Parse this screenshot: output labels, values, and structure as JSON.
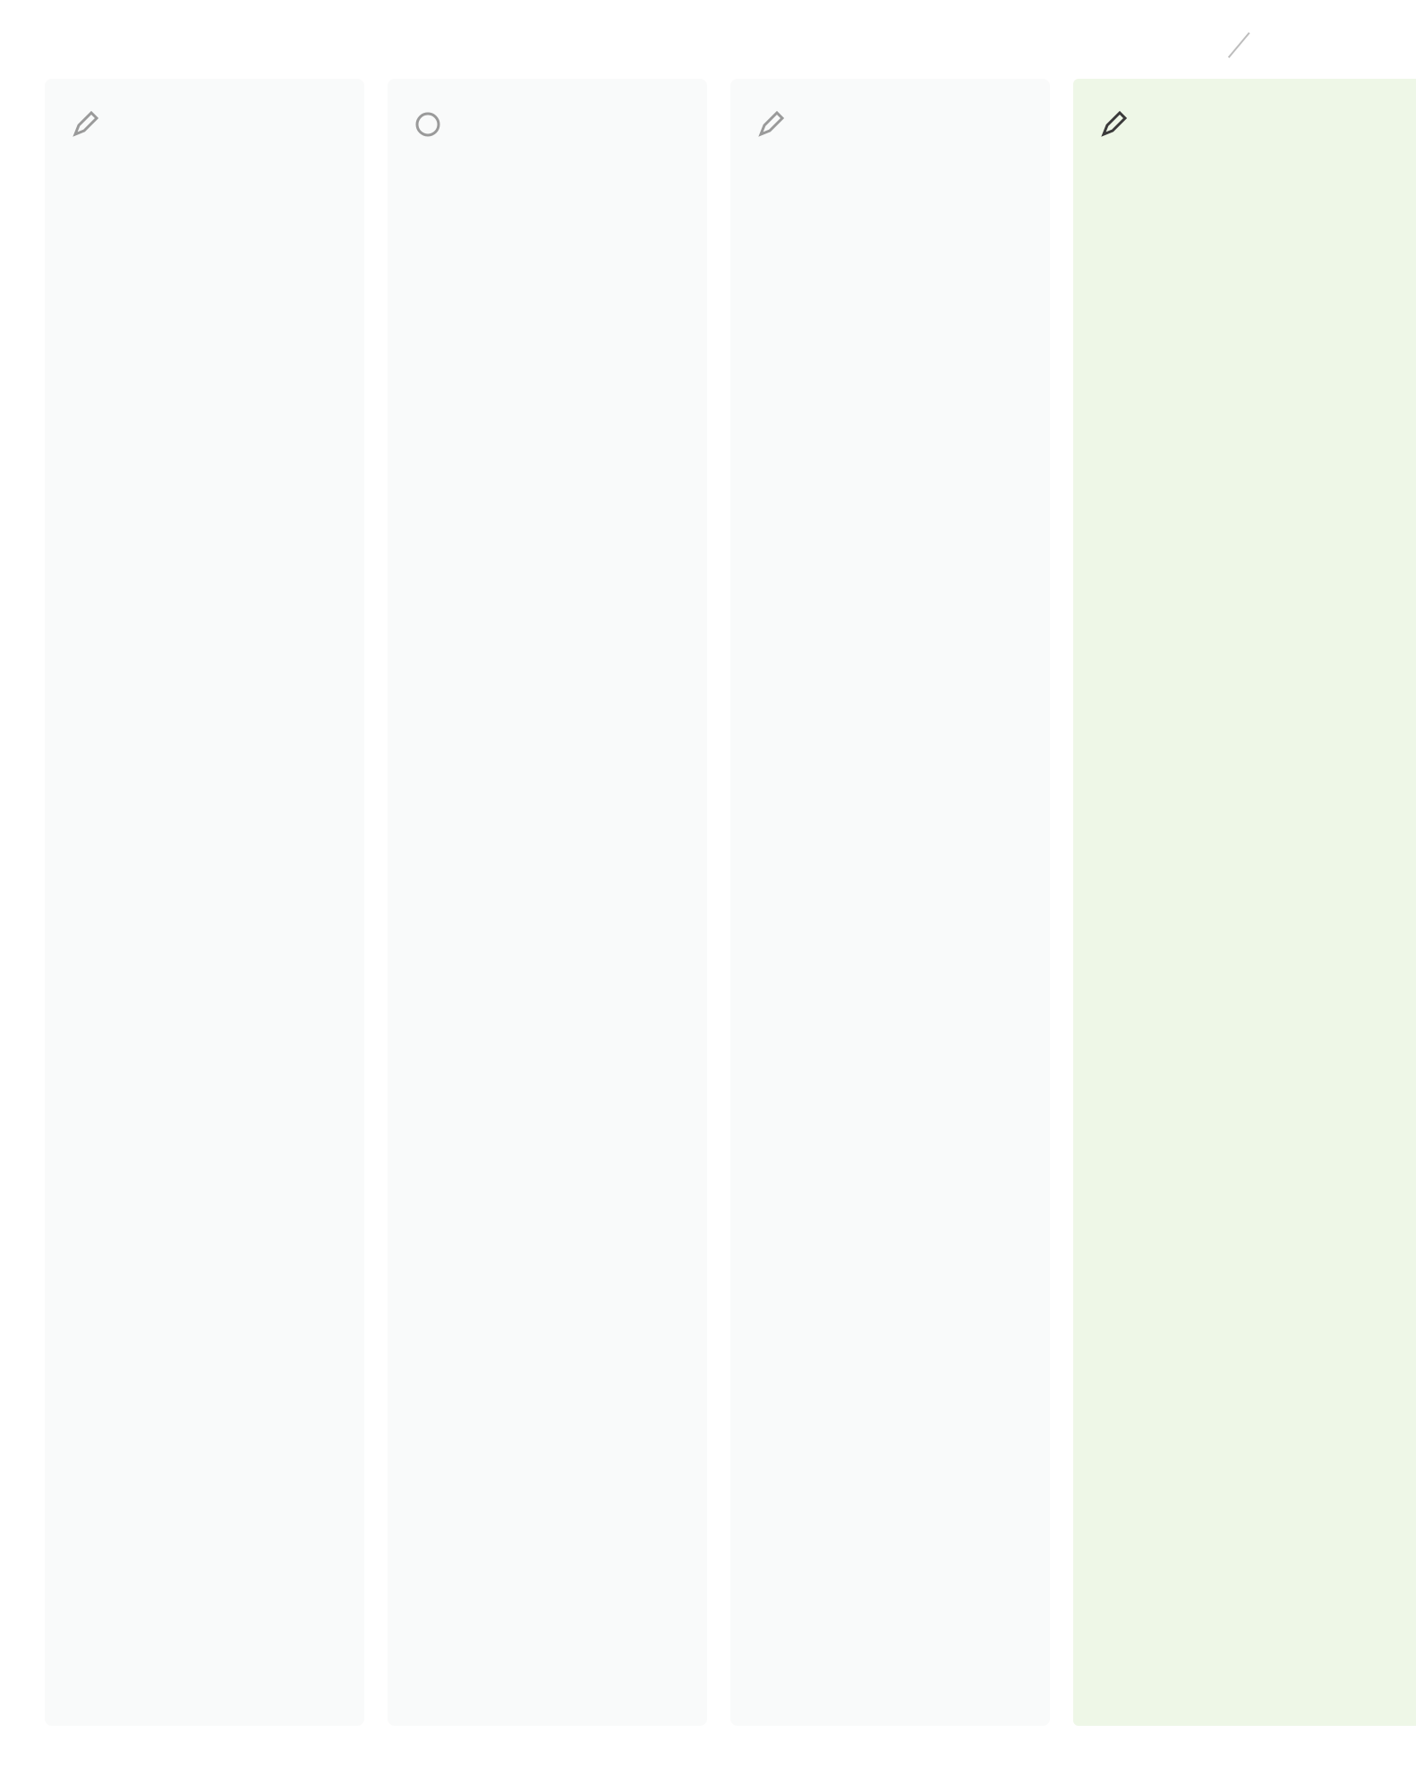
{
  "note": {
    "text": ""
  },
  "columns": [
    {
      "title": "",
      "icon": "pencil-icon",
      "sections": [
        {
          "label": "",
          "body": [
            ""
          ]
        },
        {
          "label": "",
          "body": [
            ""
          ]
        },
        {
          "label": "",
          "body": [
            ""
          ]
        },
        {
          "label": "",
          "body": [
            ""
          ]
        },
        {
          "label": "",
          "body": [
            ""
          ]
        }
      ]
    },
    {
      "title": "",
      "icon": "circle-icon",
      "sections": [
        {
          "label": "",
          "body": [
            ""
          ]
        },
        {
          "label": "",
          "body": [
            ""
          ]
        },
        {
          "label": "",
          "body": [
            ""
          ]
        },
        {
          "label": "",
          "body": [
            ""
          ]
        },
        {
          "label": "",
          "body": [
            ""
          ]
        }
      ]
    },
    {
      "title": "",
      "icon": "pencil-icon",
      "sections": [
        {
          "label": "",
          "body": [
            ""
          ]
        },
        {
          "label": "",
          "body": [
            ""
          ]
        },
        {
          "label": "",
          "body": [
            ""
          ]
        },
        {
          "label": "",
          "body": [
            ""
          ]
        },
        {
          "label": "",
          "body": [
            ""
          ]
        }
      ]
    },
    {
      "title": "",
      "icon": "pencil-icon",
      "highlight_color": "#eef7e7",
      "sections": [
        {
          "label": "",
          "body": [
            ""
          ]
        },
        {
          "label": "",
          "body": [
            ""
          ]
        },
        {
          "label": "",
          "body": [
            ""
          ]
        },
        {
          "label": "",
          "body": [
            ""
          ]
        },
        {
          "label": "",
          "body": [
            "",
            ""
          ]
        }
      ]
    }
  ],
  "colors": {
    "column_bg": "#f9fafa",
    "highlight_bg": "#eef7e7",
    "label_muted": "#c8dcb0",
    "label_highlight": "#a7cc79"
  }
}
